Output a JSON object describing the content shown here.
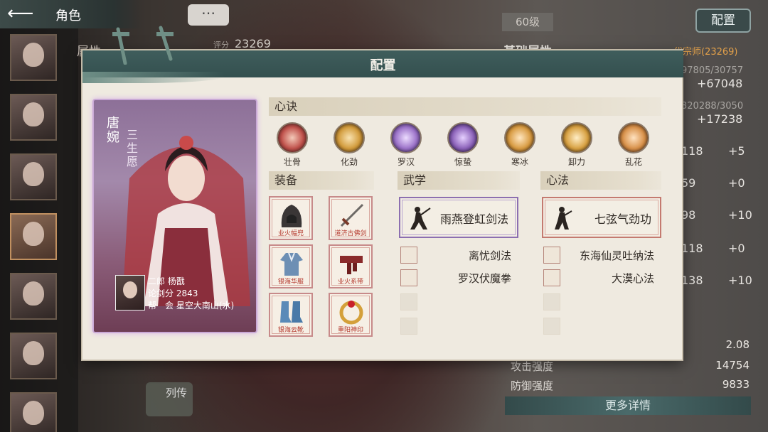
{
  "header": {
    "back_label": "角色",
    "chat_icon": "⋯",
    "score_label": "评分",
    "score_value": "23269",
    "attr_label": "属性"
  },
  "right_panel": {
    "level": "60级",
    "config_button": "配置",
    "basic_title": "基础属性",
    "master_tag": "一代宗师(23269)",
    "stats": [
      {
        "sub": "97805/30757",
        "value": "+67048"
      },
      {
        "sub": "320288/3050",
        "value": "+17238"
      },
      {
        "base": "118",
        "value": "+5"
      },
      {
        "base": "59",
        "value": "+0"
      },
      {
        "base": "98",
        "value": "+10"
      },
      {
        "base": "118",
        "value": "+0"
      },
      {
        "base": "138",
        "value": "+10"
      }
    ],
    "extra_value": "2.08",
    "attack_label": "攻击强度",
    "attack_value": "14754",
    "defense_label": "防御强度",
    "defense_value": "9833",
    "more_button": "更多详情",
    "bio_button": "列传"
  },
  "modal": {
    "title": "配置",
    "card": {
      "name": "唐婉",
      "subtitle": "三生愿",
      "line1": "二郎 杨戬",
      "line2": "论剑分 2843",
      "line3": "帮　会 星空大南山(水)"
    },
    "heart_section": "心诀",
    "heart_skills": [
      {
        "label": "壮骨",
        "color": "#c0504a"
      },
      {
        "label": "化劲",
        "color": "#d29a3a"
      },
      {
        "label": "罗汉",
        "color": "#9a70c8"
      },
      {
        "label": "惊蛰",
        "color": "#8a60b8"
      },
      {
        "label": "寒冰",
        "color": "#d89a40"
      },
      {
        "label": "卸力",
        "color": "#d8a040"
      },
      {
        "label": "乱花",
        "color": "#d89048"
      }
    ],
    "equip_section": "装备",
    "equipment": [
      {
        "label": "业火幅兜"
      },
      {
        "label": "道济古佛剑"
      },
      {
        "label": "银海华服"
      },
      {
        "label": "业火系带"
      },
      {
        "label": "银海云靴"
      },
      {
        "label": "重阳神印"
      }
    ],
    "martial_section": "武学",
    "martial_main": "雨燕登虹剑法",
    "martial_subs": [
      "离忧剑法",
      "罗汉伏魔拳"
    ],
    "inner_section": "心法",
    "inner_main": "七弦气劲功",
    "inner_subs": [
      "东海仙灵吐纳法",
      "大漠心法"
    ]
  }
}
